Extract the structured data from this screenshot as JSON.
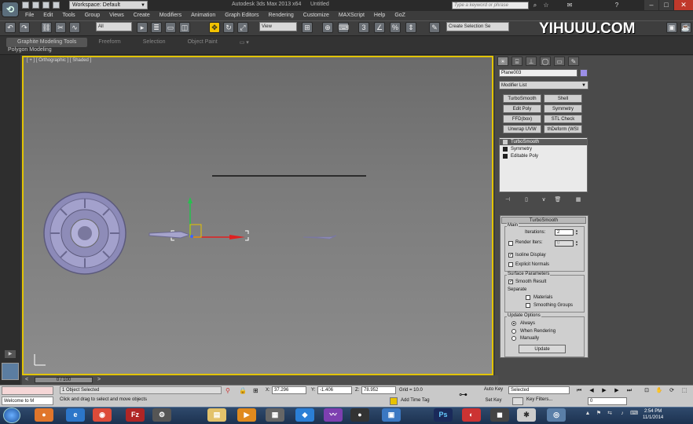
{
  "title_bar": {
    "app_title": "Autodesk 3ds Max 2013 x64      Untitled",
    "workspace": "Workspace: Default",
    "search_placeholder": "Type a keyword or phrase",
    "minimize": "–",
    "maximize": "□",
    "close": "✕"
  },
  "menu": [
    "File",
    "Edit",
    "Tools",
    "Group",
    "Views",
    "Create",
    "Modifiers",
    "Animation",
    "Graph Editors",
    "Rendering",
    "Customize",
    "MAXScript",
    "Help",
    "GoZ"
  ],
  "toolbar": {
    "filter": "All",
    "ref_coord": "View",
    "named_selection": "Create Selection Se",
    "watermark": "YIHUUU.COM"
  },
  "ribbon": {
    "tabs": [
      "Graphite Modeling Tools",
      "Freeform",
      "Selection",
      "Object Paint"
    ],
    "subtitle": "Polygon Modeling"
  },
  "viewport": {
    "label": "[ + ] [ Orthographic ] [ Shaded ]"
  },
  "command_panel": {
    "object_name": "Plane003",
    "object_color": "#9c8fe8",
    "modifier_list": "Modifier List",
    "modifier_buttons": [
      "TurboSmooth",
      "Shell",
      "Edit Poly",
      "Symmetry",
      "FFD(box)",
      "STL Check",
      "Unwrap UVW",
      "thDeform (WSI"
    ],
    "stack": [
      "TurboSmooth",
      "Symmetry",
      "Editable Poly"
    ],
    "rollout": {
      "title": "TurboSmooth",
      "main": "Main",
      "iterations_label": "Iterations:",
      "iterations_value": "2",
      "render_iters_label": "Render Iters:",
      "render_iters_value": "0",
      "isoline": "Isoline Display",
      "explicit_normals": "Explicit Normals",
      "surface_params": "Surface Parameters",
      "smooth_result": "Smooth Result",
      "separate": "Separate",
      "materials": "Materials",
      "smoothing_groups": "Smoothing Groups",
      "update_options": "Update Options",
      "always": "Always",
      "when_rendering": "When Rendering",
      "manually": "Manually",
      "update": "Update"
    }
  },
  "timeline": {
    "frame": "0 / 100"
  },
  "status": {
    "welcome": "Welcome to M",
    "selection": "1 Object Selected",
    "prompt": "Click and drag to select and move objects",
    "x_label": "X:",
    "x": "37.296",
    "y_label": "Y:",
    "y": "-1.406",
    "z_label": "Z:",
    "z": "78.952",
    "grid": "Grid = 10.0",
    "add_time_tag": "Add Time Tag",
    "auto_key": "Auto Key",
    "set_key": "Set Key",
    "selected_dropdown": "Selected",
    "key_filters": "Key Filters...",
    "current_frame": "0"
  },
  "taskbar": {
    "time": "2:54 PM",
    "date": "11/1/2014"
  }
}
